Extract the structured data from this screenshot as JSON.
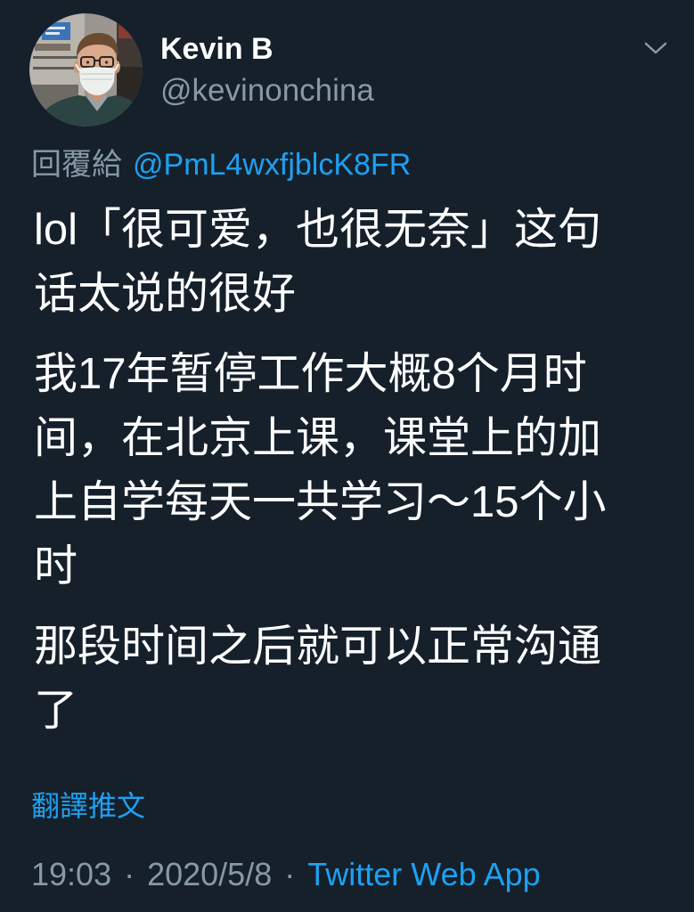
{
  "theme": {
    "background": "#15202B",
    "text": "#FFFFFF",
    "muted": "#8899A6",
    "link": "#1DA1F2"
  },
  "icons": {
    "menu": "chevron-down-icon"
  },
  "author": {
    "name": "Kevin B",
    "handle": "@kevinonchina"
  },
  "reply": {
    "prefix": "回覆給",
    "to_handle": "@PmL4wxfjblcK8FR"
  },
  "tweet": {
    "paragraphs": [
      [
        "lol「很可爱，也很无奈」这句",
        "话太说的很好"
      ],
      [
        "我17年暂停工作大概8个月时",
        "间，在北京上课，课堂上的加",
        "上自学每天一共学习～15个小",
        "时"
      ],
      [
        "那段时间之后就可以正常沟通",
        "了"
      ]
    ]
  },
  "translate_label": "翻譯推文",
  "meta": {
    "time": "19:03",
    "separator": "·",
    "date": "2020/5/8",
    "source": "Twitter Web App"
  }
}
